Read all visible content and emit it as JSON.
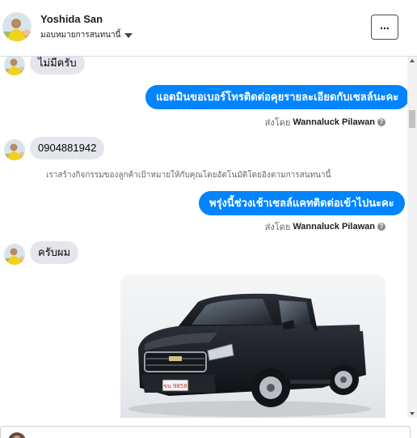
{
  "header": {
    "name": "Yoshida San",
    "subtitle": "มอบหมายการสนทนานี้"
  },
  "messages": [
    {
      "direction": "in",
      "text": "ไม่มีครับ"
    },
    {
      "direction": "out",
      "text": "แอดมินขอเบอร์โทรติดต่อคุยรายละเอียดกับเซลล์นะคะ",
      "sent_by_prefix": "ส่งโดย",
      "sent_by_name": "Wannaluck Pilawan"
    },
    {
      "direction": "in",
      "text": "0904881942"
    },
    {
      "direction": "system",
      "text": "เราสร้างกิจกรรมของลูกค้าเป้าหมายให้กับคุณโดยอัตโนมัติโดยอิงตามการสนทนานี้"
    },
    {
      "direction": "out",
      "text": "พรุ่งนี้ช่วงเช้าเซลล์แคทติดต่อเข้าไปนะคะ",
      "sent_by_prefix": "ส่งโดย",
      "sent_by_name": "Wannaluck Pilawan"
    },
    {
      "direction": "in",
      "text": "ครับผม"
    },
    {
      "direction": "out",
      "type": "image"
    }
  ],
  "car_plate": "ขน 9858",
  "icons": {
    "more": "more-options-icon",
    "caret": "caret-down-icon",
    "help": "help-icon"
  },
  "colors": {
    "outgoing_bubble": "#0084ff",
    "incoming_bubble": "#e4e6eb"
  }
}
